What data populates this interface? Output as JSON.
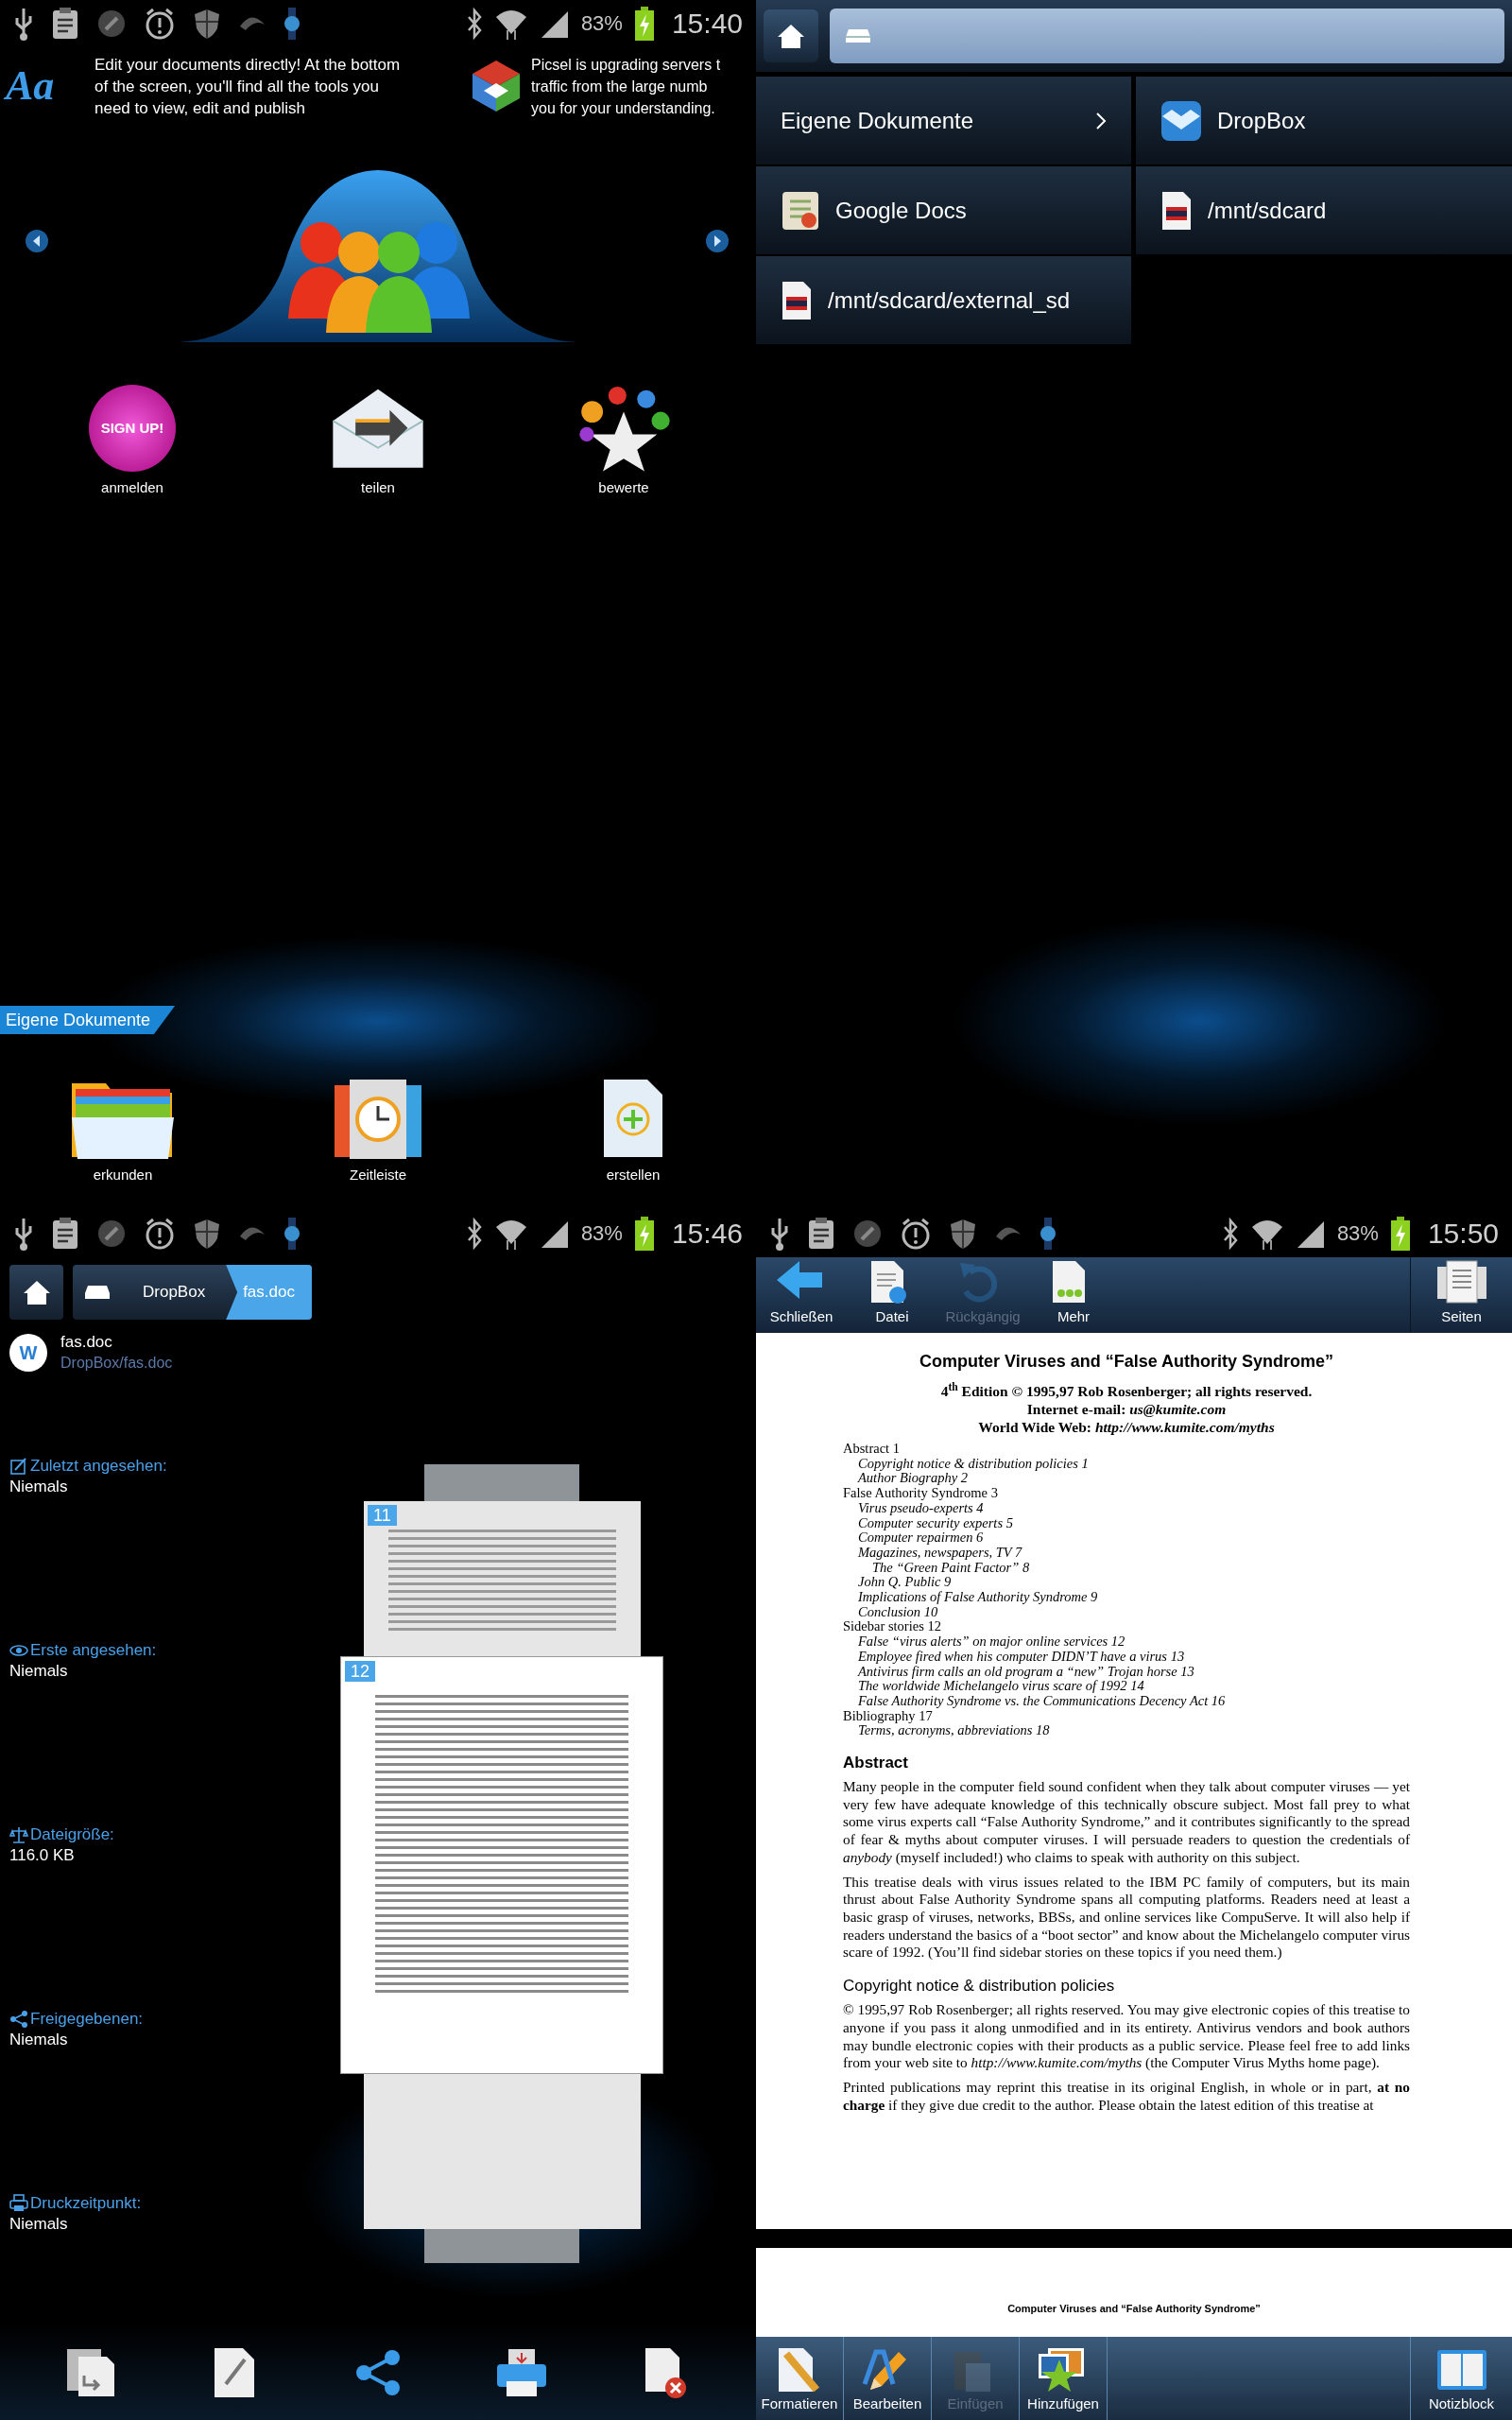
{
  "home_screen": {
    "status_bar": {
      "battery": "83%",
      "time": "15:40"
    },
    "notifications": [
      {
        "logo_text": "Aa",
        "lines": [
          "Edit your documents directly! At the bottom",
          "of the screen, you'll find all the tools you",
          "need to view, edit and publish"
        ]
      },
      {
        "lines": [
          "Picsel is upgrading servers t",
          "traffic from the large numb",
          "you for your understanding."
        ]
      }
    ],
    "apps": [
      {
        "kind": "signup",
        "label": "anmelden",
        "badge": "SIGN UP!"
      },
      {
        "kind": "mail",
        "label": "teilen"
      },
      {
        "kind": "stars",
        "label": "bewerte"
      }
    ],
    "section_tab": "Eigene Dokumente",
    "shortcuts": [
      {
        "kind": "folder",
        "label": "erkunden"
      },
      {
        "kind": "timeline",
        "label": "Zeitleiste"
      },
      {
        "kind": "new",
        "label": "erstellen"
      }
    ]
  },
  "location_picker": {
    "locations": [
      {
        "kind": "folder",
        "label": "Eigene Dokumente",
        "expandable": true
      },
      {
        "kind": "dropbox",
        "label": "DropBox",
        "expandable": false
      },
      {
        "kind": "gdocs",
        "label": "Google Docs",
        "expandable": false
      },
      {
        "kind": "sdcard",
        "label": "/mnt/sdcard",
        "expandable": false
      },
      {
        "kind": "sdcard",
        "label": "/mnt/sdcard/external_sd",
        "expandable": false
      }
    ]
  },
  "file_details": {
    "status_bar": {
      "battery": "83%",
      "time": "15:46"
    },
    "breadcrumb": [
      {
        "label": "DropBox",
        "selected": false
      },
      {
        "label": "fas.doc",
        "selected": true
      }
    ],
    "file": {
      "badge": "W",
      "name": "fas.doc",
      "path": "DropBox/fas.doc"
    },
    "info": [
      {
        "kind": "viewed",
        "label": "Zuletzt angesehen:",
        "value": "Niemals"
      },
      {
        "kind": "first",
        "label": "Erste angesehen:",
        "value": "Niemals"
      },
      {
        "kind": "size",
        "label": "Dateigröße:",
        "value": "116.0 KB"
      },
      {
        "kind": "shared",
        "label": "Freigegebenen:",
        "value": "Niemals"
      },
      {
        "kind": "printed",
        "label": "Druckzeitpunkt:",
        "value": "Niemals"
      }
    ],
    "page_previews": [
      {
        "number": "11"
      },
      {
        "number": "12"
      }
    ]
  },
  "document_viewer": {
    "status_bar": {
      "battery": "83%",
      "time": "15:50"
    },
    "toolbar": [
      {
        "kind": "back",
        "label": "Schließen",
        "disabled": false
      },
      {
        "kind": "file",
        "label": "Datei",
        "disabled": false
      },
      {
        "kind": "undo",
        "label": "Rückgängig",
        "disabled": true
      },
      {
        "kind": "more",
        "label": "Mehr",
        "disabled": false
      }
    ],
    "toolbar_right": {
      "kind": "pages",
      "label": "Seiten"
    },
    "document": {
      "title": "Computer Viruses and “False Authority Syndrome”",
      "header_lines": [
        "4$^{th}$ Edition © 1995,97 Rob Rosenberger; all rights reserved.",
        "Internet e-mail: *us@kumite.com*",
        "World Wide Web: *http://www.kumite.com/myths*"
      ],
      "toc": [
        {
          "text": "Abstract 1",
          "children": [
            {
              "text": "Copyright notice & distribution policies 1"
            },
            {
              "text": "Author Biography 2"
            }
          ]
        },
        {
          "text": "False Authority Syndrome 3",
          "children": [
            {
              "text": "Virus pseudo-experts 4"
            },
            {
              "text": "Computer security experts 5"
            },
            {
              "text": "Computer repairmen 6"
            },
            {
              "text": "Magazines, newspapers, TV 7",
              "children": [
                {
                  "text": "The “Green Paint Factor” 8"
                }
              ]
            },
            {
              "text": "John Q. Public 9"
            },
            {
              "text": "Implications of False Authority Syndrome 9"
            },
            {
              "text": "Conclusion 10"
            }
          ]
        },
        {
          "text": "Sidebar stories 12",
          "children": [
            {
              "text": "False “virus alerts” on major online services 12"
            },
            {
              "text": "Employee fired when his computer DIDN’T have a virus 13"
            },
            {
              "text": "Antivirus firm calls an old program a “new” Trojan horse 13"
            },
            {
              "text": "The worldwide Michelangelo virus scare of 1992 14"
            },
            {
              "text": "False Authority Syndrome vs. the Communications Decency Act 16"
            }
          ]
        },
        {
          "text": "Bibliography 17",
          "children": [
            {
              "text": "Terms, acronyms, abbreviations 18"
            }
          ]
        }
      ],
      "sections": [
        {
          "kind": "major",
          "heading": "Abstract",
          "paragraphs": [
            "Many people in the computer field sound confident when they talk about computer viruses — yet very few have adequate knowledge of this technically obscure subject.  Most fall prey to what some virus experts call “False Authority Syndrome,” and it contributes significantly to the spread of fear & myths about computer viruses.  I will persuade readers to question the credentials of *anybody* (myself included!) who claims to speak with authority on this subject.",
            "This treatise deals with virus issues related to the IBM PC family of computers, but its main thrust about False Authority Syndrome spans all computing platforms.  Readers need at least a basic grasp of viruses, networks, BBSs, and online services like CompuServe.  It will also help if readers understand the basics of a “boot sector” and know about the Michelangelo computer virus scare of 1992.  (You’ll find sidebar stories on these topics if you need them.)"
          ]
        },
        {
          "kind": "minor",
          "heading": "Copyright notice & distribution policies",
          "paragraphs": [
            "© 1995,97 Rob Rosenberger; all rights reserved.  You may give electronic copies of this treatise to anyone if you pass it along unmodified and in its entirety.  Antivirus vendors and book authors may bundle electronic copies with their products as a public service.  Please feel free to add links from your web site to *http://www.kumite.com/myths* (the Computer Virus Myths home page).",
            "Printed publications may reprint this treatise in its original English, in whole or in part, **at no charge** if they give due credit to the author.  Please obtain the latest edition of this treatise at"
          ]
        }
      ]
    },
    "next_page_header": "Computer Viruses and “False Authority Syndrome”",
    "bottom_toolbar": [
      {
        "kind": "format",
        "label": "Formatieren",
        "disabled": false
      },
      {
        "kind": "edit",
        "label": "Bearbeiten",
        "disabled": false
      },
      {
        "kind": "paste",
        "label": "Einfügen",
        "disabled": true
      },
      {
        "kind": "add",
        "label": "Hinzufügen",
        "disabled": false
      }
    ],
    "bottom_toolbar_right": {
      "kind": "notebook",
      "label": "Notizblock"
    }
  }
}
